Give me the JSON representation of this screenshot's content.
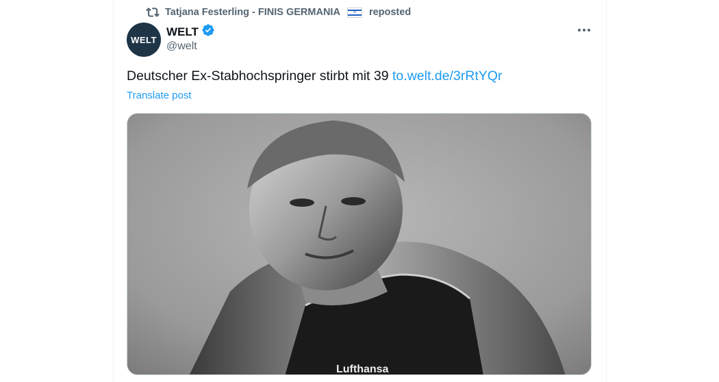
{
  "repost": {
    "icon": "repost-icon",
    "user": "Tatjana Festerling - FINIS GERMANIA",
    "flag_icon": "israel-flag-icon",
    "suffix": "reposted"
  },
  "author": {
    "avatar_text": "WELT",
    "name": "WELT",
    "verified_icon": "verified-badge-icon",
    "handle": "@welt"
  },
  "tweet": {
    "text": "Deutscher Ex-Stabhochspringer stirbt mit 39",
    "link": "to.welt.de/3rRtYQr",
    "translate": "Translate post"
  },
  "media": {
    "description_icon": "athlete-photo",
    "jersey_text": "Lufthansa"
  },
  "colors": {
    "accent": "#1d9bf0",
    "muted": "#536471",
    "text": "#0f1419",
    "avatar_bg": "#1e3447"
  }
}
